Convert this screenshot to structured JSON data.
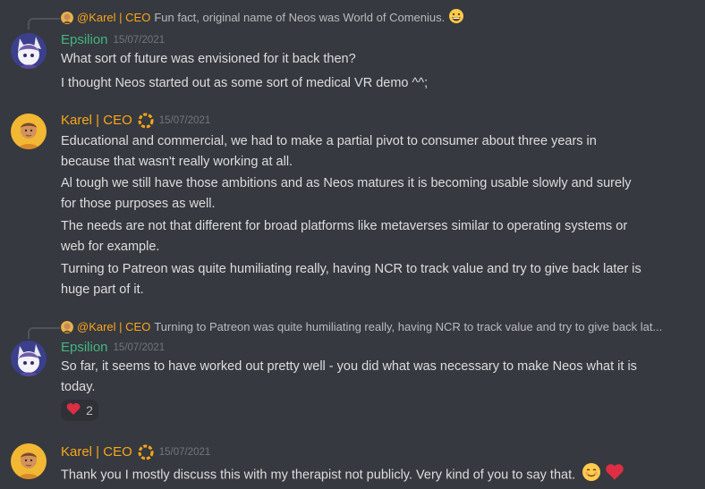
{
  "messages": [
    {
      "reply_name": "@Karel | CEO",
      "reply_text": "Fun fact, original name of Neos was World of Comenius.",
      "author": "Epsilion",
      "timestamp": "15/07/2021",
      "lines": [
        "What sort of future was envisioned for it back then?",
        "I thought Neos started out as some sort of medical VR demo ^^;"
      ]
    },
    {
      "author": "Karel | CEO",
      "timestamp": "15/07/2021",
      "lines": [
        "Educational and commercial, we had to make a partial pivot to consumer about three years in",
        "because that wasn't really working at all.",
        "Al tough we still have those ambitions and as Neos matures it is becoming usable slowly and surely",
        "for those purposes as well.",
        "The needs are not that different for broad platforms like metaverses similar to operating systems or",
        "web for example.",
        "Turning to Patreon was quite humiliating really, having NCR to track value and try to give back later is",
        "huge part of it."
      ]
    },
    {
      "reply_name": "@Karel | CEO",
      "reply_text": "Turning to Patreon was quite humiliating really, having NCR to track value and try to give back lat...",
      "author": "Epsilion",
      "timestamp": "15/07/2021",
      "lines": [
        "So far, it seems to have worked out pretty well - you did what was necessary to make Neos what it is",
        "today."
      ],
      "reaction": {
        "emoji": "heart",
        "count": "2"
      }
    },
    {
      "author": "Karel | CEO",
      "timestamp": "15/07/2021",
      "lines": [
        "Thank you I mostly discuss this with my therapist not publicly. Very kind of you to say that."
      ]
    }
  ],
  "colors": {
    "background": "#36393f",
    "text": "#dcddde",
    "epsilion_name": "#43b581",
    "karel_name": "#faa61a",
    "timestamp": "#72767d"
  },
  "icons": [
    "grinning-emoji-icon",
    "heart-icon",
    "blush-emoji-icon",
    "lifebuoy-badge-icon"
  ]
}
